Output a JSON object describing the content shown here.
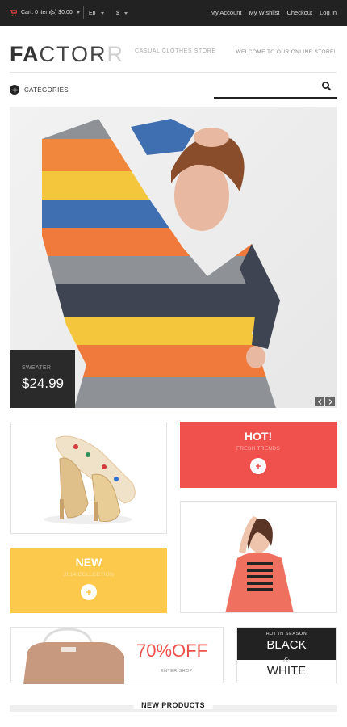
{
  "topbar": {
    "cart_text": "Cart: 0 item(s) $0.00",
    "language": "En",
    "currency": "$",
    "links": [
      "My Account",
      "My Wishlist",
      "Checkout",
      "Log In"
    ]
  },
  "brand": {
    "logo_bold": "FA",
    "logo_thin": "CTOR",
    "logo_light": "R",
    "tagline": "CASUAL CLOTHES STORE",
    "welcome": "WELCOME TO OUR ONLINE STORE!"
  },
  "nav": {
    "categories_label": "CATEGORIES"
  },
  "hero": {
    "label": "SWEATER",
    "price": "$24.99"
  },
  "banners": {
    "hot_title": "HOT!",
    "hot_sub": "FRESH TRENDS",
    "new_title": "NEW",
    "new_sub": "2014 COLLECTION",
    "sale_percent": "70%OFF",
    "sale_link": "ENTER SHOP",
    "season_label": "HOT IN SEASON",
    "season_black": "BLACK",
    "season_amp": "&",
    "season_white": "WHITE"
  },
  "sections": {
    "new_products": "NEW PRODUCTS"
  },
  "colors": {
    "accent_red": "#f0514c",
    "accent_yellow": "#fcc94d",
    "dark": "#222222"
  }
}
